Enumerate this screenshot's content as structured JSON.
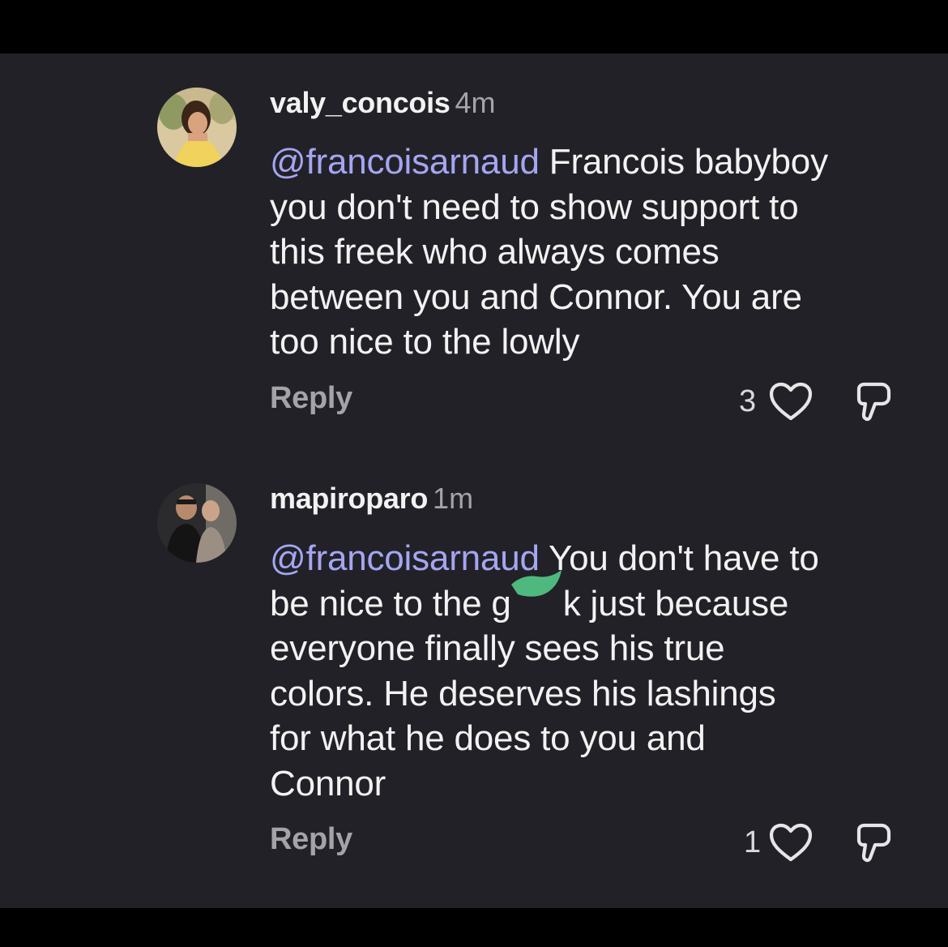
{
  "comments": [
    {
      "username": "valy_concois",
      "time": "4m",
      "mention": "@francoisarnaud",
      "lines": [
        " Francois babyboy",
        "you don't need to show support to",
        "this freek who always comes",
        "between you and Connor. You are",
        "too nice to the lowly"
      ],
      "reply_label": "Reply",
      "like_count": "3"
    },
    {
      "username": "mapiroparo",
      "time": "1m",
      "mention": "@francoisarnaud",
      "lines": [
        " You don't have to",
        "be nice to the g",
        "k just because",
        "everyone finally sees his true",
        "colors. He deserves his lashings",
        "for what he does to you and",
        "Connor"
      ],
      "reply_label": "Reply",
      "like_count": "1"
    }
  ],
  "colors": {
    "background": "#222127",
    "mention": "#a4a6f2",
    "censor_mark": "#4fb87f"
  },
  "icons": [
    "heart-icon",
    "dislike-icon"
  ]
}
